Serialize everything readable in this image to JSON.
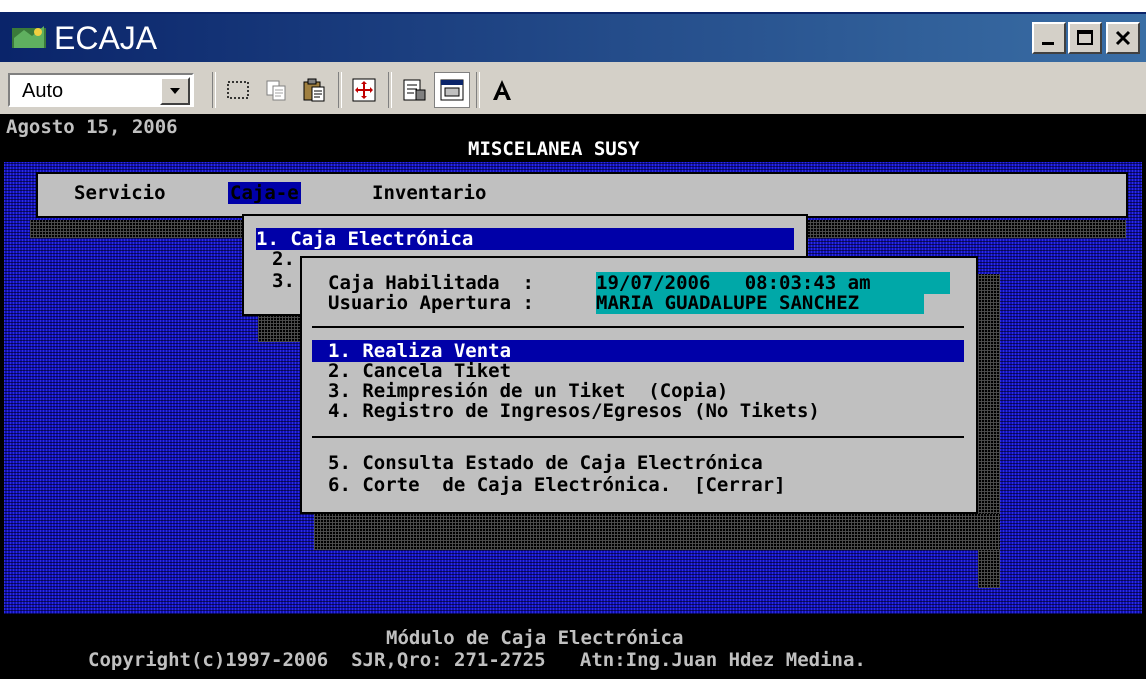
{
  "window": {
    "title": "ECAJA"
  },
  "toolbar": {
    "font_size_value": "Auto"
  },
  "console": {
    "date": "Agosto 15, 2006",
    "company": "MISCELANEA SUSY",
    "menu": [
      "Servicio",
      "Caja-e",
      "Inventario"
    ],
    "submenu_caja": [
      "1. Caja Electrónica",
      "2.",
      "3."
    ],
    "caja_habilitada_label": "Caja Habilitada  :",
    "caja_habilitada_value": "19/07/2006   08:03:43 am",
    "usuario_apertura_label": "Usuario Apertura :",
    "usuario_apertura_value": "MARIA GUADALUPE SANCHEZ",
    "options": [
      "1. Realiza Venta",
      "2. Cancela Tiket",
      "3. Reimpresión de un Tiket  (Copia)",
      "4. Registro de Ingresos/Egresos (No Tikets)",
      "5. Consulta Estado de Caja Electrónica",
      "6. Corte  de Caja Electrónica.  [Cerrar]"
    ],
    "footer_module": "Módulo de Caja Electrónica",
    "footer_copyright": "Copyright(c)1997-2006  SJR,Qro: 271-2725   Atn:Ing.Juan Hdez Medina."
  },
  "colors": {
    "titlebar": "#0a246a",
    "console_bg": "#1010b8",
    "highlight": "#0000a8",
    "teal": "#00a8a8",
    "dialog_bg": "#c0c0c0"
  },
  "icons": [
    "app-icon",
    "minimize-icon",
    "maximize-icon",
    "close-icon",
    "dropdown-arrow-icon",
    "mark-icon",
    "copy-icon",
    "paste-icon",
    "fullscreen-icon",
    "properties-icon",
    "background-icon",
    "font-icon"
  ]
}
